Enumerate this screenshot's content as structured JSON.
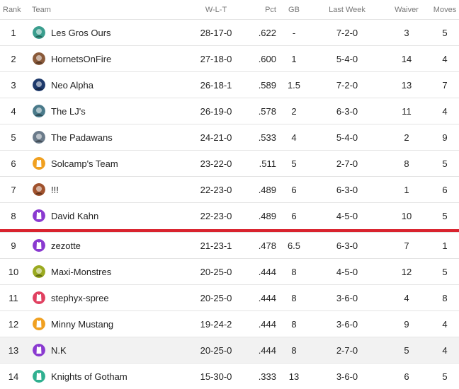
{
  "headers": {
    "rank": "Rank",
    "team": "Team",
    "wlt": "W-L-T",
    "pct": "Pct",
    "gb": "GB",
    "last_week": "Last Week",
    "waiver": "Waiver",
    "moves": "Moves"
  },
  "colors": {
    "cutline": "#d9232e",
    "highlight_row": "#f2f2f2"
  },
  "rows": [
    {
      "rank": "1",
      "team": "Les Gros Ours",
      "wlt": "28-17-0",
      "pct": ".622",
      "gb": "-",
      "last_week": "7-2-0",
      "waiver": "3",
      "moves": "5",
      "icon": "bear-team-logo-icon",
      "color": "#3a9e8e"
    },
    {
      "rank": "2",
      "team": "HornetsOnFire",
      "wlt": "27-18-0",
      "pct": ".600",
      "gb": "1",
      "last_week": "5-4-0",
      "waiver": "14",
      "moves": "4",
      "icon": "hornet-team-logo-icon",
      "color": "#8a5a3a"
    },
    {
      "rank": "3",
      "team": "Neo Alpha",
      "wlt": "26-18-1",
      "pct": ".589",
      "gb": "1.5",
      "last_week": "7-2-0",
      "waiver": "13",
      "moves": "7",
      "icon": "neo-alpha-team-logo-icon",
      "color": "#1e3a6b"
    },
    {
      "rank": "4",
      "team": "The LJ's",
      "wlt": "26-19-0",
      "pct": ".578",
      "gb": "2",
      "last_week": "6-3-0",
      "waiver": "11",
      "moves": "4",
      "icon": "lj-team-logo-icon",
      "color": "#4a7a8a"
    },
    {
      "rank": "5",
      "team": "The Padawans",
      "wlt": "24-21-0",
      "pct": ".533",
      "gb": "4",
      "last_week": "5-4-0",
      "waiver": "2",
      "moves": "9",
      "icon": "padawan-team-logo-icon",
      "color": "#6b7b8a"
    },
    {
      "rank": "6",
      "team": "Solcamp's Team",
      "wlt": "23-22-0",
      "pct": ".511",
      "gb": "5",
      "last_week": "2-7-0",
      "waiver": "8",
      "moves": "5",
      "icon": "jersey-logo-icon",
      "color": "#f0a020"
    },
    {
      "rank": "7",
      "team": "!!!",
      "wlt": "22-23-0",
      "pct": ".489",
      "gb": "6",
      "last_week": "6-3-0",
      "waiver": "1",
      "moves": "6",
      "icon": "player-photo-icon",
      "color": "#a0522d"
    },
    {
      "rank": "8",
      "team": "David Kahn",
      "wlt": "22-23-0",
      "pct": ".489",
      "gb": "6",
      "last_week": "4-5-0",
      "waiver": "10",
      "moves": "5",
      "icon": "jersey-logo-icon",
      "color": "#8a3ad0"
    },
    {
      "rank": "9",
      "team": "zezotte",
      "wlt": "21-23-1",
      "pct": ".478",
      "gb": "6.5",
      "last_week": "6-3-0",
      "waiver": "7",
      "moves": "1",
      "icon": "jersey-logo-icon",
      "color": "#8a3ad0"
    },
    {
      "rank": "10",
      "team": "Maxi-Monstres",
      "wlt": "20-25-0",
      "pct": ".444",
      "gb": "8",
      "last_week": "4-5-0",
      "waiver": "12",
      "moves": "5",
      "icon": "monster-team-logo-icon",
      "color": "#9aaa20"
    },
    {
      "rank": "11",
      "team": "stephyx-spree",
      "wlt": "20-25-0",
      "pct": ".444",
      "gb": "8",
      "last_week": "3-6-0",
      "waiver": "4",
      "moves": "8",
      "icon": "jersey-logo-icon",
      "color": "#e04060"
    },
    {
      "rank": "12",
      "team": "Minny Mustang",
      "wlt": "19-24-2",
      "pct": ".444",
      "gb": "8",
      "last_week": "3-6-0",
      "waiver": "9",
      "moves": "4",
      "icon": "jersey-logo-icon",
      "color": "#f0a020"
    },
    {
      "rank": "13",
      "team": "N.K",
      "wlt": "20-25-0",
      "pct": ".444",
      "gb": "8",
      "last_week": "2-7-0",
      "waiver": "5",
      "moves": "4",
      "icon": "jersey-logo-icon",
      "color": "#8a3ad0",
      "highlighted": true
    },
    {
      "rank": "14",
      "team": "Knights of Gotham",
      "wlt": "15-30-0",
      "pct": ".333",
      "gb": "13",
      "last_week": "3-6-0",
      "waiver": "6",
      "moves": "5",
      "icon": "jersey-logo-icon",
      "color": "#30b090"
    }
  ]
}
